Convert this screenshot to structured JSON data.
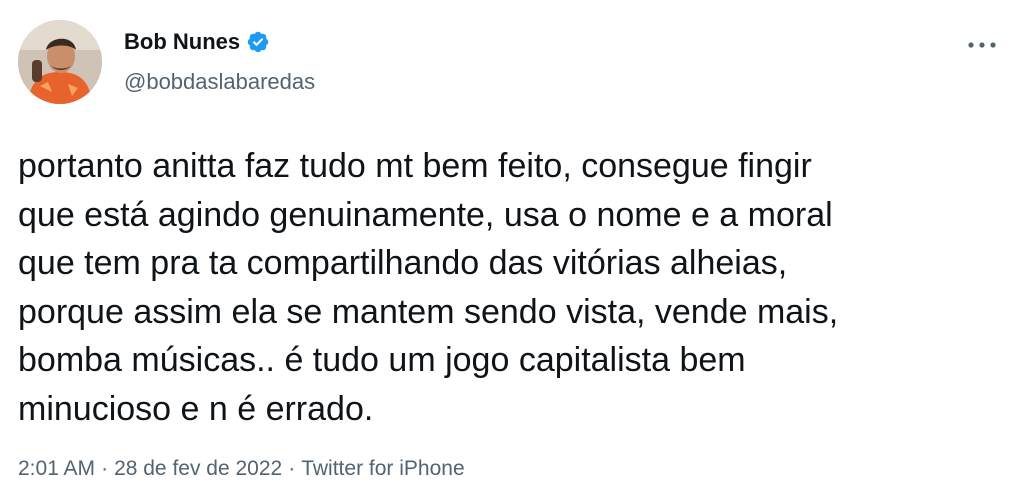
{
  "author": {
    "display_name": "Bob Nunes",
    "handle": "@bobdaslabaredas",
    "verified": true,
    "avatar_icon": "user-avatar-photo"
  },
  "tweet": {
    "text": "portanto anitta faz tudo mt bem feito, consegue fingir\nque está agindo genuinamente, usa o nome e a moral\nque tem pra ta compartilhando das vitórias alheias,\nporque assim ela se mantem sendo vista, vende mais,\nbomba músicas.. é tudo um jogo capitalista bem\nminucioso e n é errado."
  },
  "meta": {
    "time": "2:01 AM",
    "separator": "·",
    "date": "28 de fev de 2022",
    "source": "Twitter for iPhone"
  },
  "icons": {
    "verified": "verified-badge-icon",
    "more": "more-options-icon"
  },
  "colors": {
    "text_primary": "#0f1419",
    "text_secondary": "#536471",
    "verified_blue": "#1d9bf0",
    "background": "#ffffff"
  }
}
